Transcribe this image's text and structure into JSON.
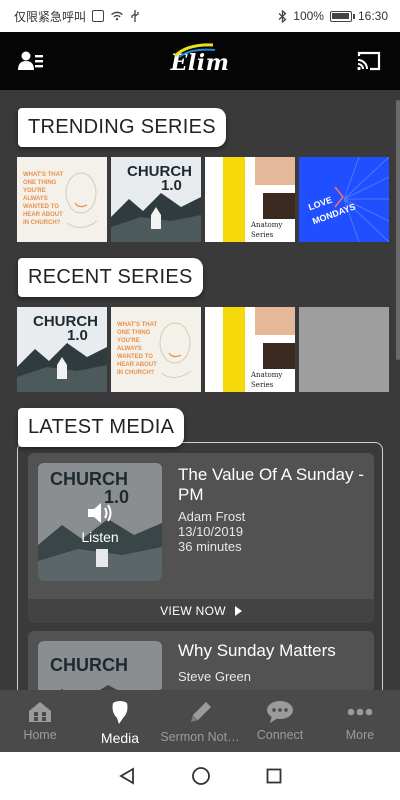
{
  "status_bar": {
    "carrier": "仅限紧急呼叫",
    "battery": "100%",
    "battery_level": 1.0,
    "time": "16:30"
  },
  "header": {
    "logo_text": "Elim",
    "icons": [
      "profile-list-icon",
      "cast-icon"
    ]
  },
  "sections": {
    "trending_label": "TRENDING SERIES",
    "recent_label": "RECENT SERIES",
    "latest_label": "LATEST MEDIA"
  },
  "thumb_text": {
    "church_title": "CHURCH",
    "church_version": "1.0",
    "question_lines": [
      "WHAT'S THAT",
      "ONE THING",
      "YOU'RE ALWAYS",
      "WANTED TO",
      "HEAR ABOUT",
      "IN CHURCH?"
    ],
    "anatomy": "Anatomy",
    "anatomy_sub": "Series",
    "love": "LOVE",
    "mondays": "MONDAYS"
  },
  "media": [
    {
      "title": "The Value Of A Sunday - PM",
      "speaker": "Adam Frost",
      "date": "13/10/2019",
      "duration": "36 minutes",
      "action": "Listen",
      "view_now": "VIEW NOW"
    },
    {
      "title": "Why Sunday Matters",
      "speaker": "Steve Green"
    }
  ],
  "tabs": [
    {
      "label": "Home",
      "icon": "home-icon"
    },
    {
      "label": "Media",
      "icon": "mic-icon",
      "active": true
    },
    {
      "label": "Sermon Not…",
      "icon": "pencil-icon"
    },
    {
      "label": "Connect",
      "icon": "chat-bubble-icon"
    },
    {
      "label": "More",
      "icon": "more-dots-icon"
    }
  ],
  "colors": {
    "background": "#3a3a3a",
    "header": "#050505",
    "card": "#525252",
    "accent_yellow": "#f5d90a",
    "love_blue": "#1f4fff",
    "logo_yellow": "#e8e21a",
    "logo_blue": "#1e88e5"
  }
}
